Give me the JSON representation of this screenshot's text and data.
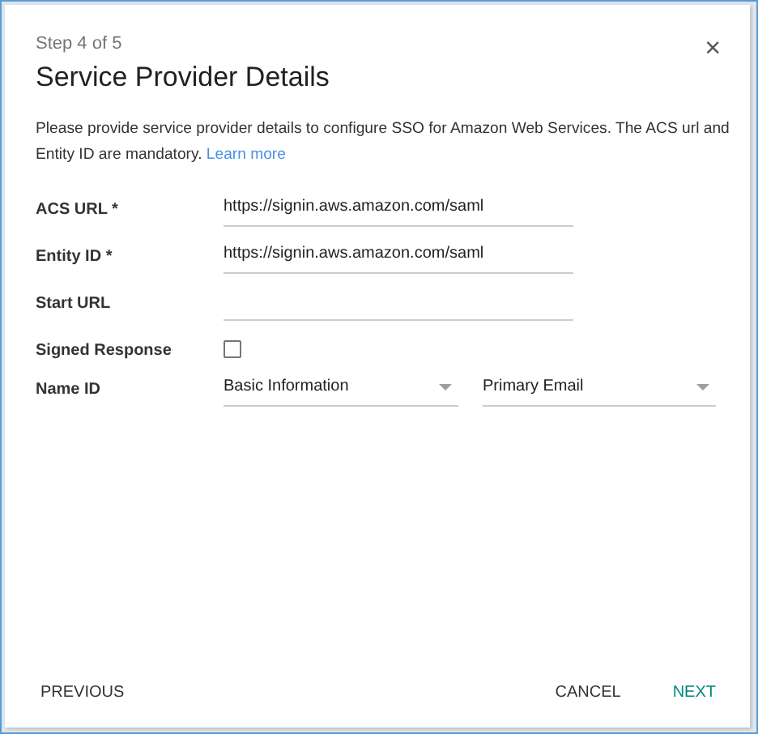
{
  "dialog": {
    "step": "Step 4 of 5",
    "title": "Service Provider Details",
    "close_icon": "×",
    "description": "Please provide service provider details to configure SSO for Amazon Web Services. The ACS url and Entity ID are mandatory.",
    "learn_more": "Learn more"
  },
  "fields": [
    {
      "kind": "text",
      "label": "ACS URL *",
      "value": "https://signin.aws.amazon.com/saml"
    },
    {
      "kind": "text",
      "label": "Entity ID *",
      "value": "https://signin.aws.amazon.com/saml"
    },
    {
      "kind": "text",
      "label": "Start URL"
    },
    {
      "kind": "checkbox",
      "label": "Signed Response",
      "checked": false
    },
    {
      "kind": "selects",
      "label": "Name ID",
      "options": [
        "Basic Information",
        "Primary Email"
      ]
    }
  ],
  "buttons": {
    "previous": "PREVIOUS",
    "cancel": "CANCEL",
    "next": "NEXT"
  }
}
